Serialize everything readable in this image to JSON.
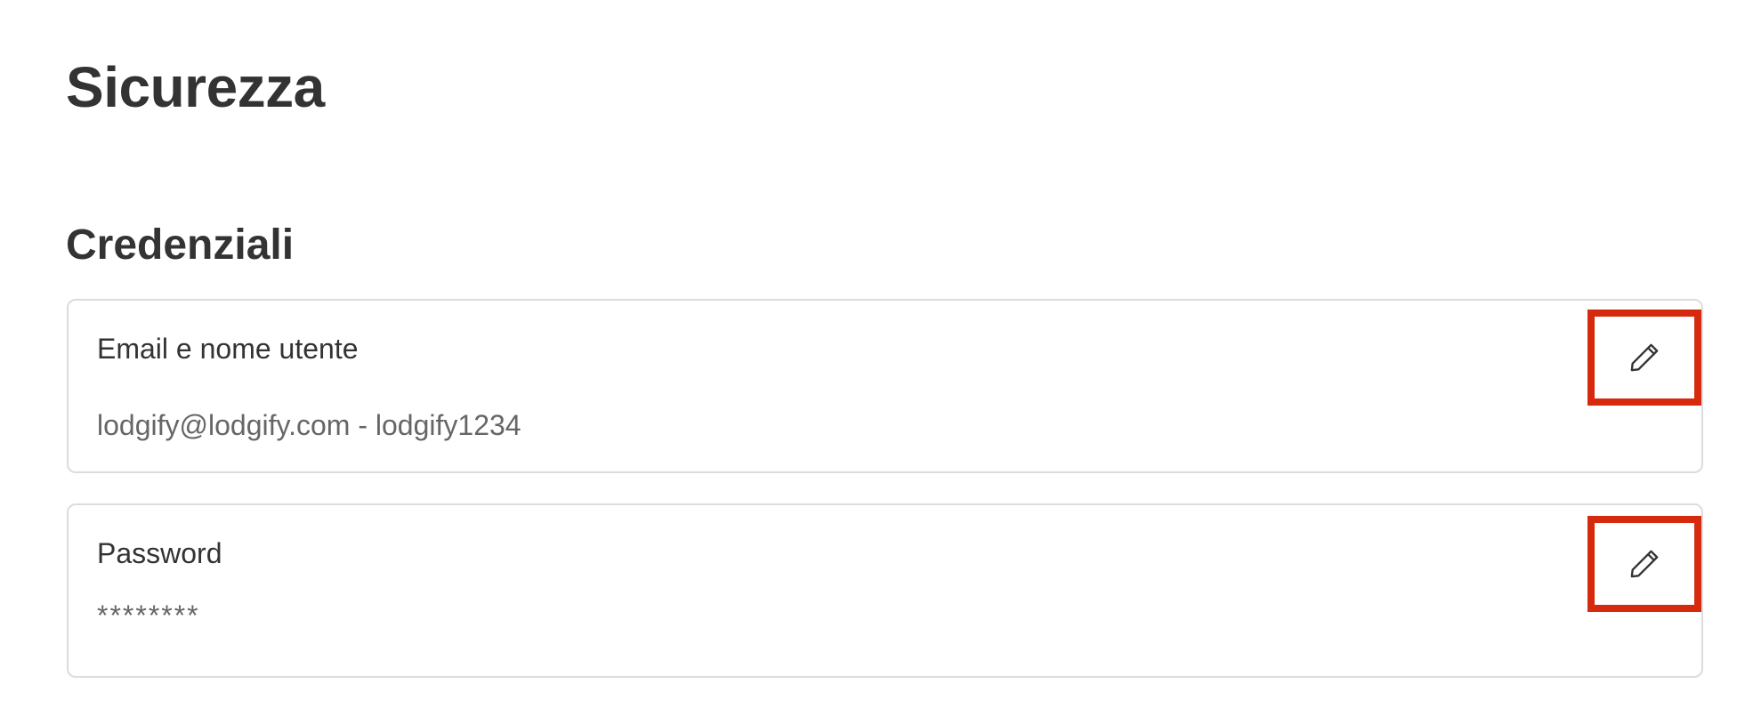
{
  "page": {
    "title": "Sicurezza"
  },
  "credentials": {
    "section_title": "Credenziali",
    "email_card": {
      "label": "Email e nome utente",
      "value": "lodgify@lodgify.com - lodgify1234",
      "edit_icon": "pencil-icon"
    },
    "password_card": {
      "label": "Password",
      "value": "********",
      "edit_icon": "pencil-icon"
    }
  },
  "colors": {
    "text": "#333333",
    "muted_text": "#666666",
    "card_border": "#dcdcdc",
    "highlight": "#d62a0f"
  }
}
